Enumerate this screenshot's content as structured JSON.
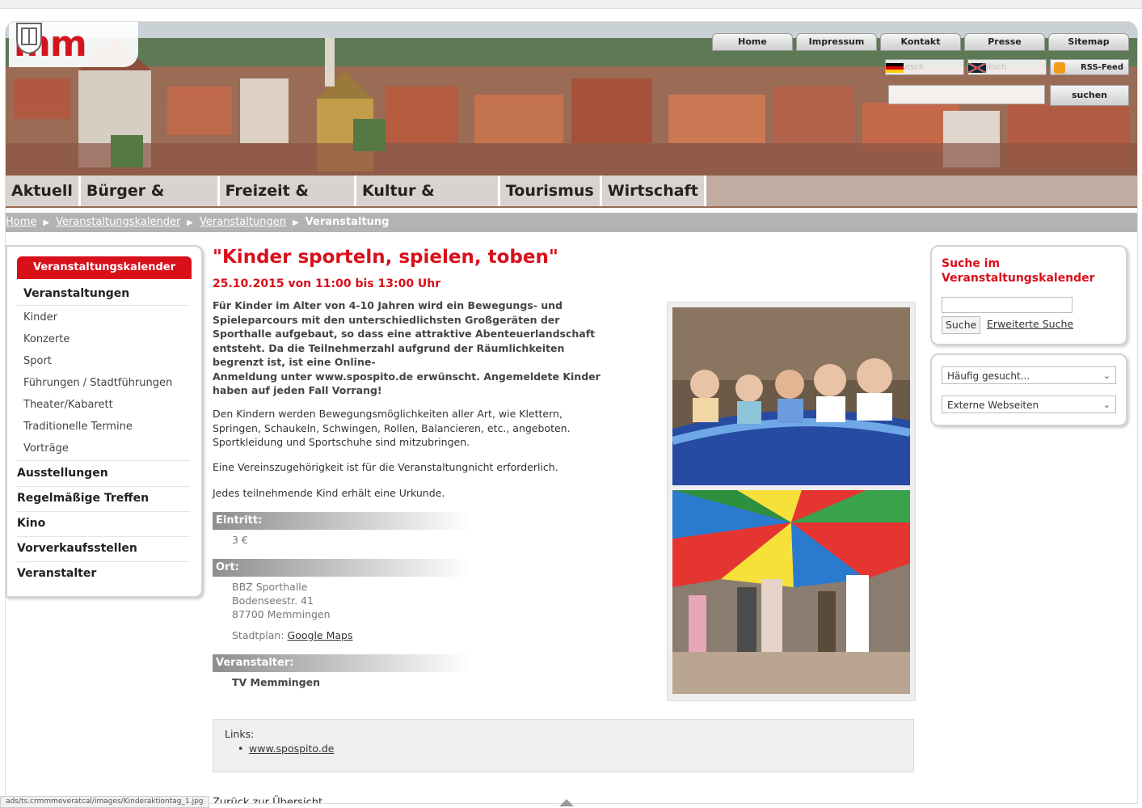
{
  "logo": {
    "text": "mm"
  },
  "top_nav": [
    "Home",
    "Impressum",
    "Kontakt",
    "Presse",
    "Sitemap"
  ],
  "languages": [
    {
      "label": "Deutsch",
      "flag": "de-flag-icon"
    },
    {
      "label": "Englisch",
      "flag": "uk-flag-icon"
    }
  ],
  "rss_label": "RSS-Feed",
  "search_button": "suchen",
  "main_nav": [
    "Aktuell",
    "Bürger & Politik",
    "Freizeit & Sport",
    "Kultur & Bildung",
    "Tourismus",
    "Wirtschaft"
  ],
  "breadcrumb": {
    "items": [
      "Home",
      "Veranstaltungskalender",
      "Veranstaltungen"
    ],
    "current": "Veranstaltung"
  },
  "sidebar": {
    "header": "Veranstaltungskalender",
    "active": "Veranstaltungen",
    "sub_items": [
      "Kinder",
      "Konzerte",
      "Sport",
      "Führungen / Stadtführungen",
      "Theater/Kabarett",
      "Traditionelle Termine",
      "Vorträge"
    ],
    "main_items": [
      "Ausstellungen",
      "Regelmäßige Treffen",
      "Kino",
      "Vorverkaufsstellen",
      "Veranstalter"
    ]
  },
  "event": {
    "title": "\"Kinder sporteln, spielen, toben\"",
    "date": "25.10.2015 von 11:00 bis 13:00 Uhr",
    "intro_lines": [
      "Für Kinder im Alter von 4-10 Jahren wird ein Bewegungs- und",
      "Spieleparcours mit den unterschiedlichsten Großgeräten der",
      "Sporthalle aufgebaut, so dass eine attraktive Abenteuerlandschaft",
      "entsteht. Da die Teilnehmerzahl aufgrund der Räumlichkeiten",
      "begrenzt ist, ist eine Online-",
      "Anmeldung unter www.spospito.de erwünscht. Angemeldete Kinder",
      "haben auf jeden Fall Vorrang!"
    ],
    "para2_lines": [
      "Den Kindern werden Bewegungsmöglichkeiten aller Art, wie Klettern,",
      "Springen, Schaukeln, Schwingen, Rollen, Balancieren, etc., angeboten.",
      "Sportkleidung und Sportschuhe sind mitzubringen."
    ],
    "para3": "Eine Vereinszugehörigkeit ist für die Veranstaltungnicht erforderlich.",
    "para4": "Jedes teilnehmende Kind erhält eine Urkunde.",
    "eintritt_label": "Eintritt:",
    "eintritt_value": "3 €",
    "ort_label": "Ort:",
    "ort_lines": [
      "BBZ Sporthalle",
      "Bodenseestr. 41",
      "87700 Memmingen"
    ],
    "stadtplan_label": "Stadtplan:",
    "stadtplan_link": "Google Maps",
    "veranstalter_label": "Veranstalter:",
    "veranstalter_value": "TV Memmingen",
    "links_label": "Links:",
    "links": [
      "www.spospito.de"
    ],
    "back_link": "Zurück zur Übersicht"
  },
  "right_sidebar": {
    "search_title": "Suche im Veranstaltungskalender",
    "search_button": "Suche",
    "advanced_link": "Erweiterte Suche",
    "select1": "Häufig gesucht...",
    "select2": "Externe Webseiten"
  },
  "status_url": "ads/ts.crmmmeveratcal/images/Kinderaktiontag_1.jpg",
  "colors": {
    "accent": "#d90f1a",
    "breadcrumb_bg": "#b3b3b3",
    "nav_bg": "#e1e1e1"
  }
}
